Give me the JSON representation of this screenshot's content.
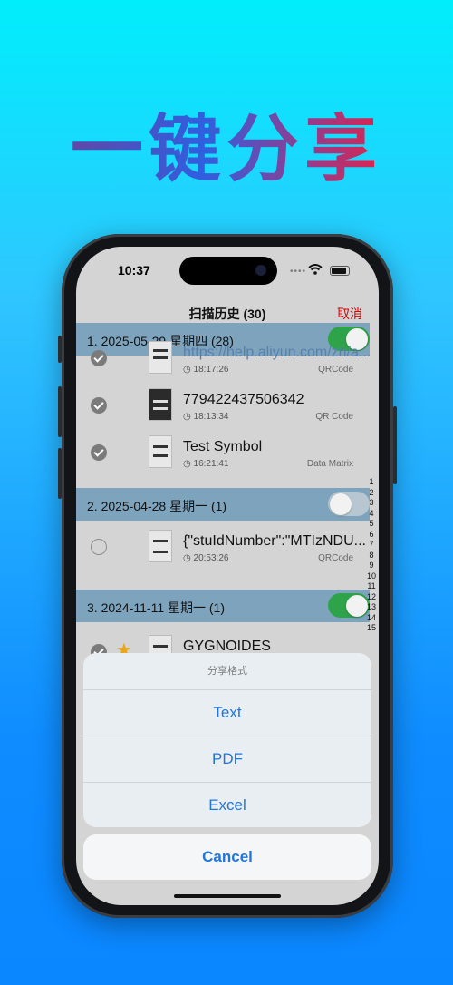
{
  "headline": "一键分享",
  "status": {
    "time": "10:37"
  },
  "nav": {
    "title": "扫描历史 (30)",
    "cancel": "取消"
  },
  "sections": [
    {
      "title": "1. 2025-05-29  星期四 (28)",
      "toggle": "on"
    },
    {
      "title": "2. 2025-04-28  星期一 (1)",
      "toggle": "off"
    },
    {
      "title": "3. 2024-11-11  星期一 (1)",
      "toggle": "on"
    }
  ],
  "rows": [
    {
      "title": "https://help.aliyun.com/zh/a...",
      "time": "18:17:26",
      "type": "QRCode",
      "checked": true
    },
    {
      "title": "779422437506342",
      "time": "18:13:34",
      "type": "QR Code",
      "checked": true
    },
    {
      "title": "Test Symbol",
      "time": "16:21:41",
      "type": "Data Matrix",
      "checked": true
    },
    {
      "title": "{\"stuIdNumber\":\"MTIzNDU...",
      "time": "20:53:26",
      "type": "QRCode",
      "checked": false
    },
    {
      "title": "GYGNOIDES",
      "time": "",
      "type": "",
      "checked": true
    }
  ],
  "index_labels": [
    "1",
    "2",
    "3",
    "4",
    "5",
    "6",
    "7",
    "8",
    "9",
    "10",
    "11",
    "12",
    "13",
    "14",
    "15"
  ],
  "sheet": {
    "header": "分享格式",
    "options": [
      "Text",
      "PDF",
      "Excel"
    ],
    "cancel": "Cancel"
  },
  "colors": {
    "accent": "#2276d8",
    "cancel_red": "#d40000",
    "toggle_on": "#2fa34a",
    "section_bg": "#7ea4bd"
  },
  "icons": [
    "wifi-icon",
    "battery-icon",
    "clock-icon",
    "star-icon"
  ]
}
